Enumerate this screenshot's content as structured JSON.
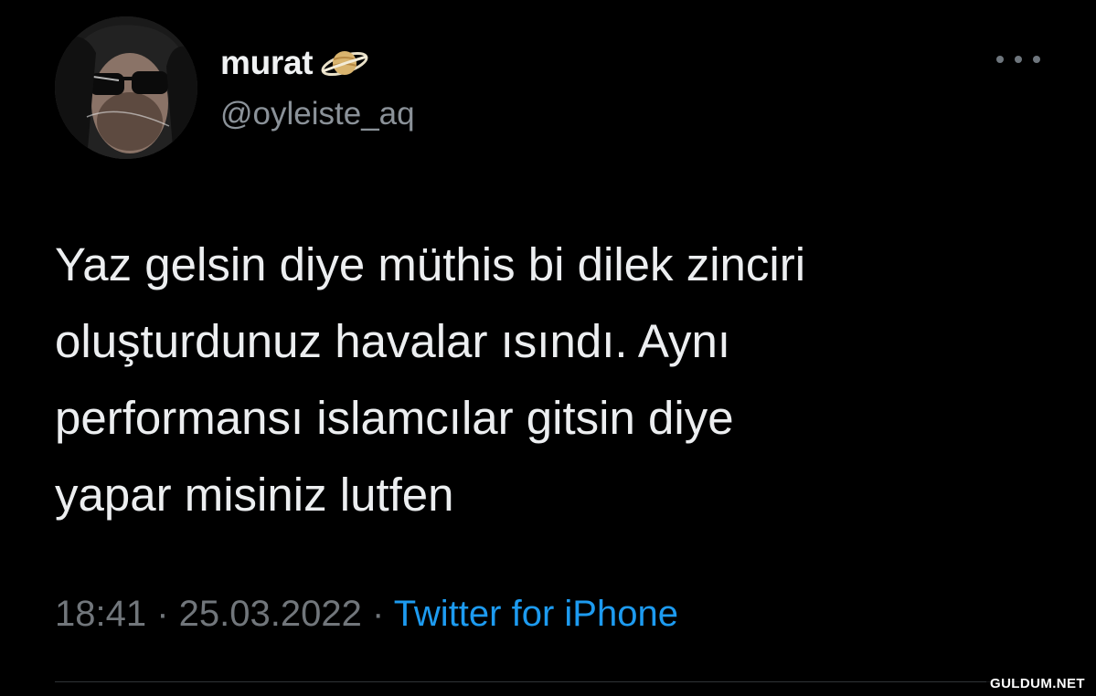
{
  "author": {
    "display_name": "murat",
    "name_emoji": "ringed-planet-icon",
    "handle": "@oyleiste_aq",
    "avatar": "avatar-photo"
  },
  "tweet": {
    "lines": [
      "Yaz gelsin diye müthis bi dilek zinciri",
      "oluşturdunuz havalar ısındı. Aynı",
      "performansı islamcılar gitsin diye",
      "yapar misiniz lutfen"
    ]
  },
  "meta": {
    "time": "18:41",
    "separator_1": " · ",
    "date": "25.03.2022",
    "separator_2": " · ",
    "source": "Twitter for iPhone"
  },
  "watermark": "GULDUM.NET",
  "colors": {
    "background": "#000000",
    "text_primary": "#e7e9ea",
    "text_secondary": "#71767b",
    "link": "#1d9bf0"
  }
}
